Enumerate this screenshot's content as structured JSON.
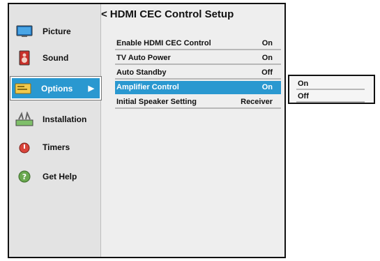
{
  "sidebar": {
    "items": [
      {
        "label": "Picture",
        "icon": "monitor-icon",
        "selected": false
      },
      {
        "label": "Sound",
        "icon": "speaker-icon",
        "selected": false
      },
      {
        "label": "Options",
        "icon": "options-folder-icon",
        "selected": true,
        "arrow": "▶"
      },
      {
        "label": "Installation",
        "icon": "installation-icon",
        "selected": false
      },
      {
        "label": "Timers",
        "icon": "timer-icon",
        "selected": false
      },
      {
        "label": "Get Help",
        "icon": "help-icon",
        "selected": false
      }
    ]
  },
  "main": {
    "back_symbol": "<",
    "title": "HDMI CEC Control Setup",
    "rows": [
      {
        "label": "Enable HDMI CEC Control",
        "value": "On",
        "selected": false
      },
      {
        "label": "TV Auto Power",
        "value": "On",
        "selected": false
      },
      {
        "label": "Auto Standby",
        "value": "Off",
        "selected": false
      },
      {
        "label": "Amplifier Control",
        "value": "On",
        "selected": true
      },
      {
        "label": "Initial Speaker Setting",
        "value": "Receiver",
        "selected": false
      }
    ]
  },
  "popup": {
    "options": [
      "On",
      "Off"
    ]
  },
  "colors": {
    "accent": "#2a98d0",
    "panel": "#eeeeee",
    "sidebar": "#e3e3e3"
  }
}
